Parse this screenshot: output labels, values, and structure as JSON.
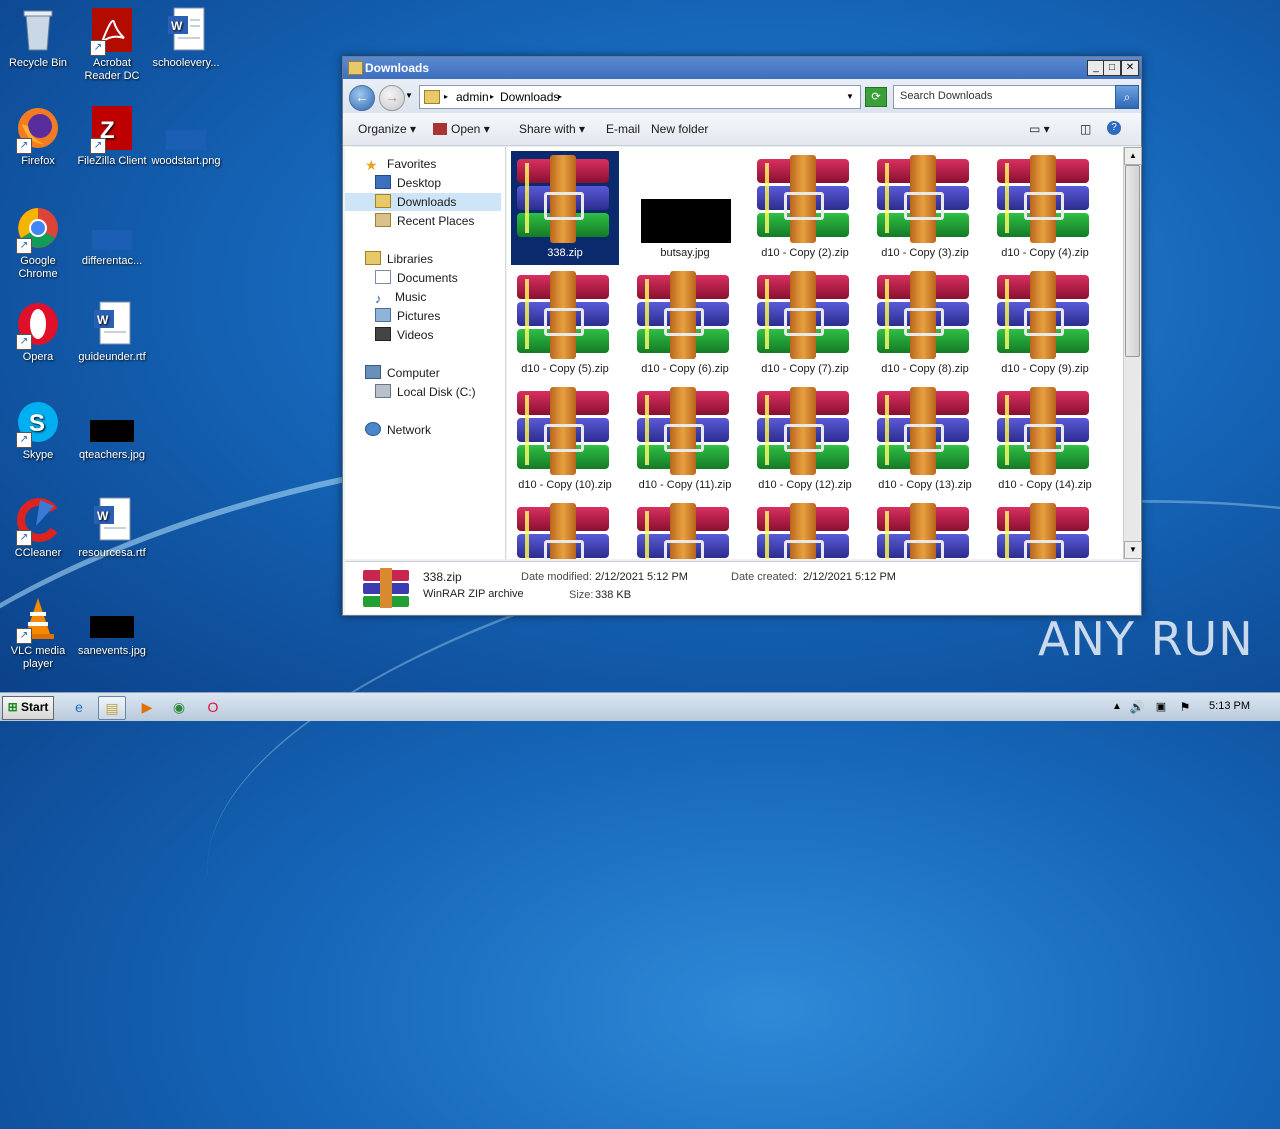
{
  "desktop": {
    "icons": [
      {
        "label": "Recycle Bin"
      },
      {
        "label": "Acrobat Reader DC"
      },
      {
        "label": "schoolevery..."
      },
      {
        "label": "Firefox"
      },
      {
        "label": "FileZilla Client"
      },
      {
        "label": "woodstart.png"
      },
      {
        "label": "Google Chrome"
      },
      {
        "label": "differentac..."
      },
      {
        "label": "Opera"
      },
      {
        "label": "guideunder.rtf"
      },
      {
        "label": "Skype"
      },
      {
        "label": "qteachers.jpg"
      },
      {
        "label": "CCleaner"
      },
      {
        "label": "resourcesa.rtf"
      },
      {
        "label": "VLC media player"
      },
      {
        "label": "sanevents.jpg"
      }
    ],
    "watermark": "ANY RUN"
  },
  "window": {
    "title": "Downloads",
    "controls": {
      "minimize": "_",
      "maximize": "□",
      "close": "✕"
    },
    "address": {
      "segments": [
        "admin",
        "Downloads"
      ],
      "sep": "▸"
    },
    "search_placeholder": "Search Downloads",
    "toolbar": {
      "organize": "Organize",
      "open": "Open",
      "share_with": "Share with",
      "email": "E-mail",
      "new_folder": "New folder"
    },
    "nav": {
      "favorites": "Favorites",
      "desktop": "Desktop",
      "downloads": "Downloads",
      "recent_places": "Recent Places",
      "libraries": "Libraries",
      "documents": "Documents",
      "music": "Music",
      "pictures": "Pictures",
      "videos": "Videos",
      "computer": "Computer",
      "local_disk": "Local Disk (C:)",
      "network": "Network"
    },
    "files": [
      {
        "name": "338.zip",
        "kind": "rar",
        "selected": true
      },
      {
        "name": "butsay.jpg",
        "kind": "jpg"
      },
      {
        "name": "d10 - Copy (2).zip",
        "kind": "rar"
      },
      {
        "name": "d10 - Copy (3).zip",
        "kind": "rar"
      },
      {
        "name": "d10 - Copy (4).zip",
        "kind": "rar"
      },
      {
        "name": "d10 - Copy (5).zip",
        "kind": "rar"
      },
      {
        "name": "d10 - Copy (6).zip",
        "kind": "rar"
      },
      {
        "name": "d10 - Copy (7).zip",
        "kind": "rar"
      },
      {
        "name": "d10 - Copy (8).zip",
        "kind": "rar"
      },
      {
        "name": "d10 - Copy (9).zip",
        "kind": "rar"
      },
      {
        "name": "d10 - Copy (10).zip",
        "kind": "rar"
      },
      {
        "name": "d10 - Copy (11).zip",
        "kind": "rar"
      },
      {
        "name": "d10 - Copy (12).zip",
        "kind": "rar"
      },
      {
        "name": "d10 - Copy (13).zip",
        "kind": "rar"
      },
      {
        "name": "d10 - Copy (14).zip",
        "kind": "rar"
      },
      {
        "name": "",
        "kind": "rar"
      },
      {
        "name": "",
        "kind": "rar"
      },
      {
        "name": "",
        "kind": "rar"
      },
      {
        "name": "",
        "kind": "rar"
      },
      {
        "name": "",
        "kind": "rar"
      }
    ],
    "details": {
      "name": "338.zip",
      "type": "WinRAR ZIP archive",
      "modified_label": "Date modified:",
      "modified": "2/12/2021 5:12 PM",
      "created_label": "Date created:",
      "created": "2/12/2021 5:12 PM",
      "size_label": "Size:",
      "size": "338 KB"
    }
  },
  "taskbar": {
    "start": "Start",
    "clock": "5:13 PM"
  }
}
